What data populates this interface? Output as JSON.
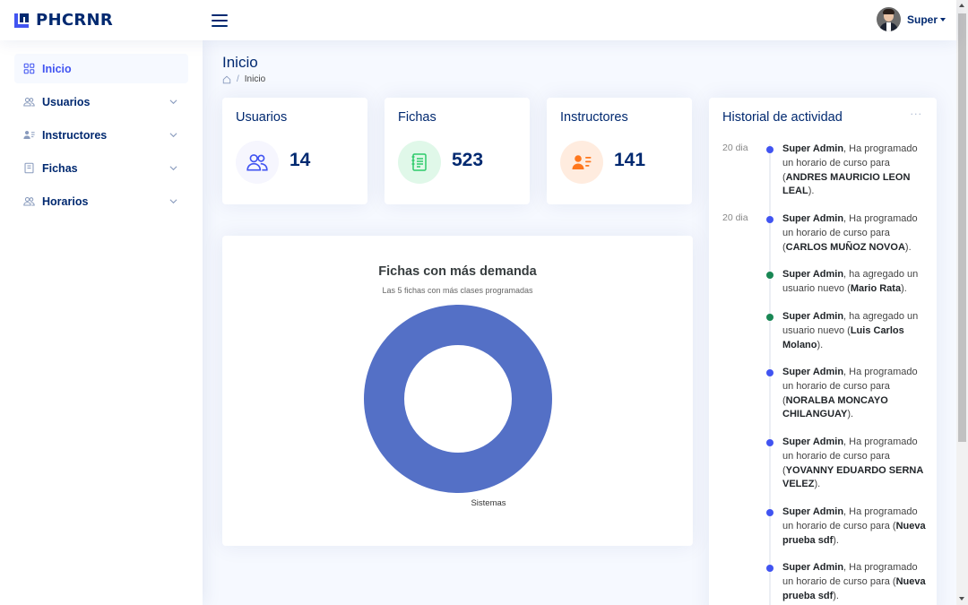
{
  "header": {
    "logo_text": "PHCRNR",
    "profile_name": "Super"
  },
  "sidebar": {
    "items": [
      {
        "label": "Inicio",
        "icon": "grid-icon"
      },
      {
        "label": "Usuarios",
        "icon": "people-icon"
      },
      {
        "label": "Instructores",
        "icon": "person-lines-icon"
      },
      {
        "label": "Fichas",
        "icon": "journal-icon"
      },
      {
        "label": "Horarios",
        "icon": "people-icon"
      }
    ]
  },
  "page": {
    "title": "Inicio",
    "breadcrumb": {
      "current": "Inicio",
      "separator": "/"
    }
  },
  "stats": [
    {
      "title": "Usuarios",
      "value": "14",
      "icon": "people-icon",
      "icon_color": "#4154f1",
      "bg": "#f6f6fe"
    },
    {
      "title": "Fichas",
      "value": "523",
      "icon": "journal-text-icon",
      "icon_color": "#2eca6a",
      "bg": "#e0f8e9"
    },
    {
      "title": "Instructores",
      "value": "141",
      "icon": "person-lines-icon",
      "icon_color": "#ff771d",
      "bg": "#ffecdf"
    }
  ],
  "chart_data": {
    "type": "pie",
    "title": "Fichas con más demanda",
    "subtitle": "Las 5 fichas con más clases programadas",
    "categories": [
      "Sistemas"
    ],
    "values": [
      100
    ],
    "colors": [
      "#5470c6"
    ],
    "legend": "none"
  },
  "activity": {
    "title": "Historial de actividad",
    "more": "···",
    "items": [
      {
        "time": "20 dia",
        "actor": "Super Admin",
        "text": ", Ha programado un horario de curso para (",
        "target": "ANDRES MAURICIO LEON LEAL",
        "end": ").",
        "dot_color": "#4154f1"
      },
      {
        "time": "20 dia",
        "actor": "Super Admin",
        "text": ", Ha programado un horario de curso para (",
        "target": "CARLOS MUÑOZ NOVOA",
        "end": ").",
        "dot_color": "#4154f1"
      },
      {
        "time": "",
        "actor": "Super Admin",
        "text": ", ha agregado un usuario nuevo (",
        "target": "Mario Rata",
        "end": ").",
        "dot_color": "#198754"
      },
      {
        "time": "",
        "actor": "Super Admin",
        "text": ", ha agregado un usuario nuevo (",
        "target": "Luis Carlos Molano",
        "end": ").",
        "dot_color": "#198754"
      },
      {
        "time": "",
        "actor": "Super Admin",
        "text": ", Ha programado un horario de curso para (",
        "target": "NORALBA MONCAYO CHILANGUAY",
        "end": ").",
        "dot_color": "#4154f1"
      },
      {
        "time": "",
        "actor": "Super Admin",
        "text": ", Ha programado un horario de curso para (",
        "target": "YOVANNY EDUARDO SERNA VELEZ",
        "end": ").",
        "dot_color": "#4154f1"
      },
      {
        "time": "",
        "actor": "Super Admin",
        "text": ", Ha programado un horario de curso para (",
        "target": "Nueva prueba sdf",
        "end": ").",
        "dot_color": "#4154f1"
      },
      {
        "time": "",
        "actor": "Super Admin",
        "text": ", Ha programado un horario de curso para (",
        "target": "Nueva prueba sdf",
        "end": ").",
        "dot_color": "#4154f1"
      }
    ]
  }
}
